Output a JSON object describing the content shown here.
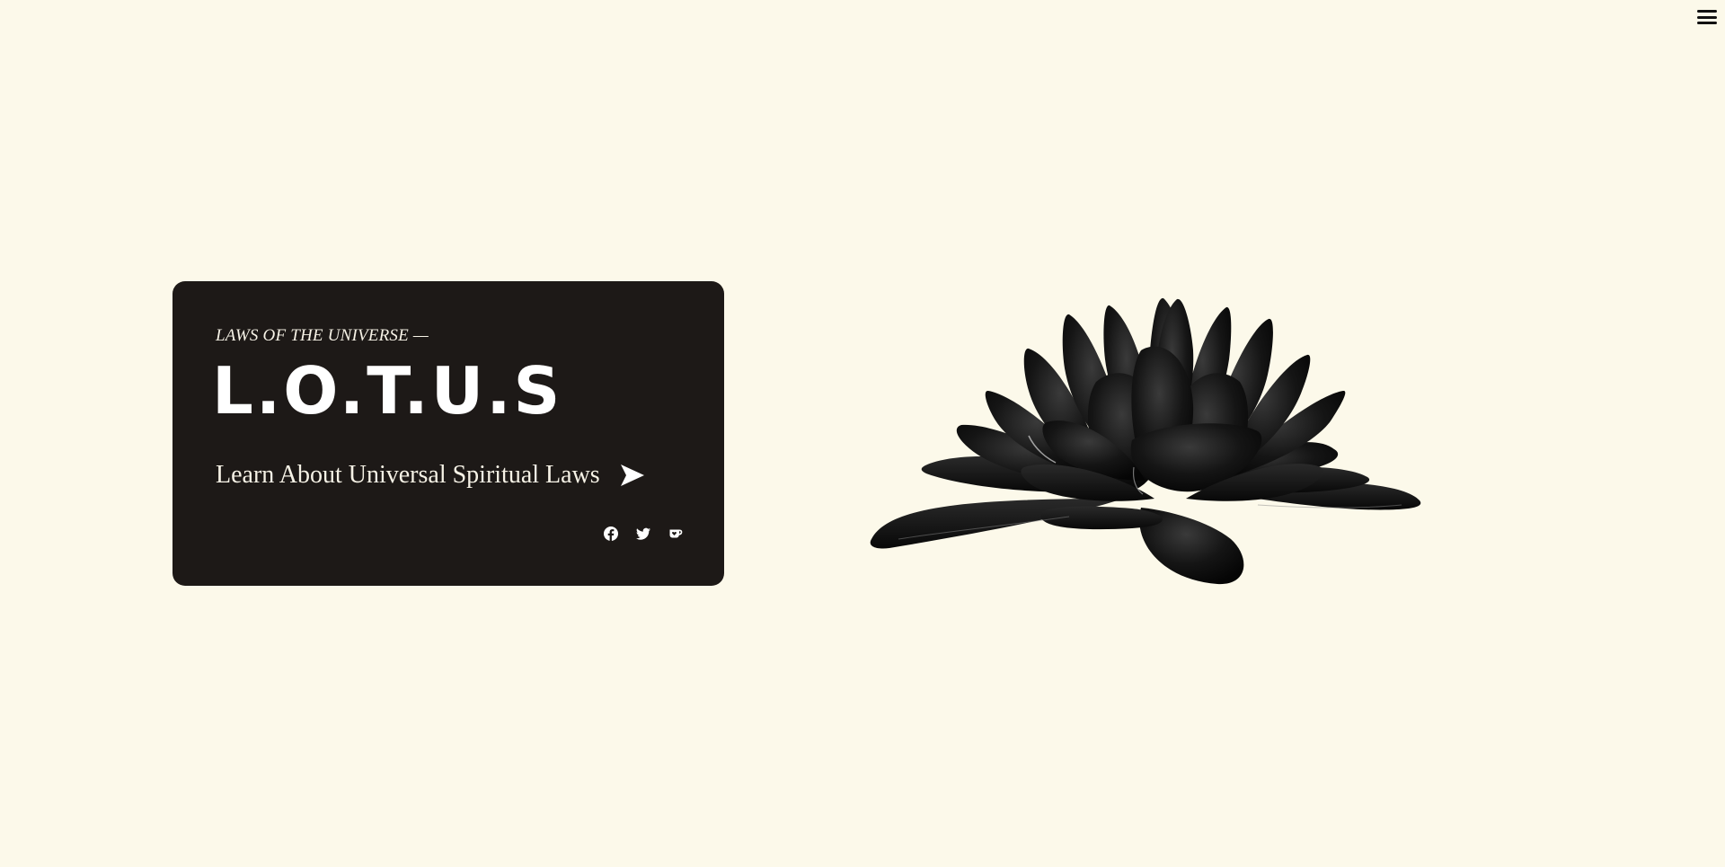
{
  "hero": {
    "eyebrow": "LAWS OF THE UNIVERSE —",
    "title": "L.O.T.U.S",
    "cta_label": "Learn About Universal Spiritual Laws",
    "cta_icon": "arrow-right-icon"
  },
  "header": {
    "menu_icon": "hamburger-menu-icon"
  },
  "socials": [
    {
      "icon": "facebook-icon"
    },
    {
      "icon": "twitter-icon"
    },
    {
      "icon": "kofi-cup-icon"
    }
  ],
  "illustration": {
    "icon": "lotus-flower-illustration"
  },
  "colors": {
    "background": "#FCF9EA",
    "card": "#1D1917",
    "text_light": "#FFFFFF",
    "lotus": "#141414"
  }
}
